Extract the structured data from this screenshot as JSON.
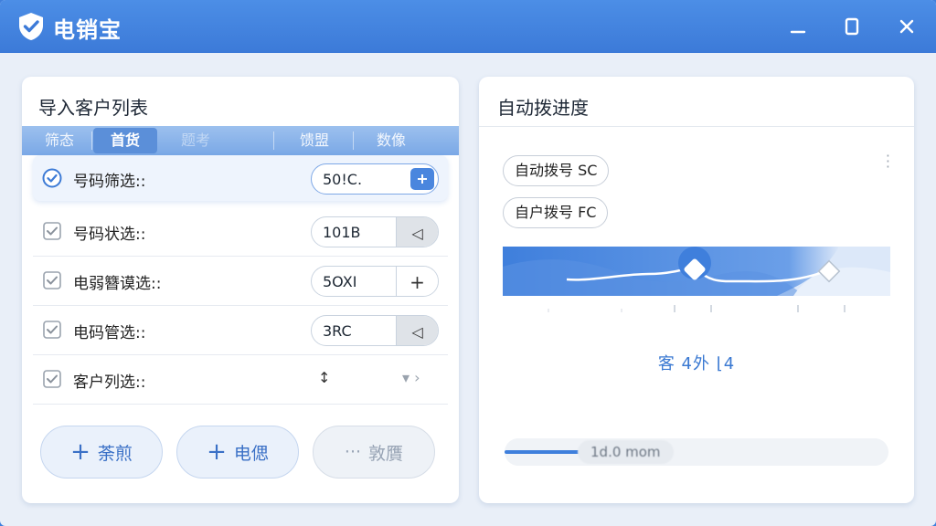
{
  "app": {
    "title": "电销宝"
  },
  "left_panel": {
    "title": "导入客户列表",
    "tabs": [
      {
        "label": "筛态",
        "active": false
      },
      {
        "label": "首货",
        "active": true
      },
      {
        "label": "题考",
        "active": false
      },
      {
        "label": "馈盟",
        "active": false
      },
      {
        "label": "数像",
        "active": false
      }
    ],
    "rows": [
      {
        "label": "号码筛选::",
        "checked": true,
        "value": "50!C.",
        "action_icon": "plus-arrow-icon",
        "action": "╋"
      },
      {
        "label": "号码状选::",
        "checked": true,
        "value": "101B",
        "action_icon": "arrow-icon",
        "action": "◁"
      },
      {
        "label": "电弱簪谟选::",
        "checked": true,
        "value": "5OXI",
        "action_icon": "plus-icon",
        "action": "+"
      },
      {
        "label": "电码管选::",
        "checked": true,
        "value": "3RC",
        "action_icon": "arrow-icon",
        "action": "◁"
      },
      {
        "label": "客户列选::",
        "checked": true,
        "value": "↕",
        "action_icon": "dropdown-icon",
        "action": "▾ ›"
      }
    ],
    "buttons": [
      {
        "label": "荼煎",
        "icon": "plus-icon"
      },
      {
        "label": "电偲",
        "icon": "plus-icon"
      },
      {
        "label": "敦贋",
        "icon": "ellipsis-icon"
      }
    ]
  },
  "right_panel": {
    "title": "自动拨进度",
    "tags": [
      "自动拨号 SC",
      "自户拨号 FC"
    ],
    "status": "客 4外 ⌊4",
    "progress": {
      "label": "1d.0 mom",
      "fraction": 0.2
    }
  },
  "colors": {
    "titlebar": "#3c7ad8",
    "accent": "#4a86de",
    "status_text": "#3a79d2"
  }
}
